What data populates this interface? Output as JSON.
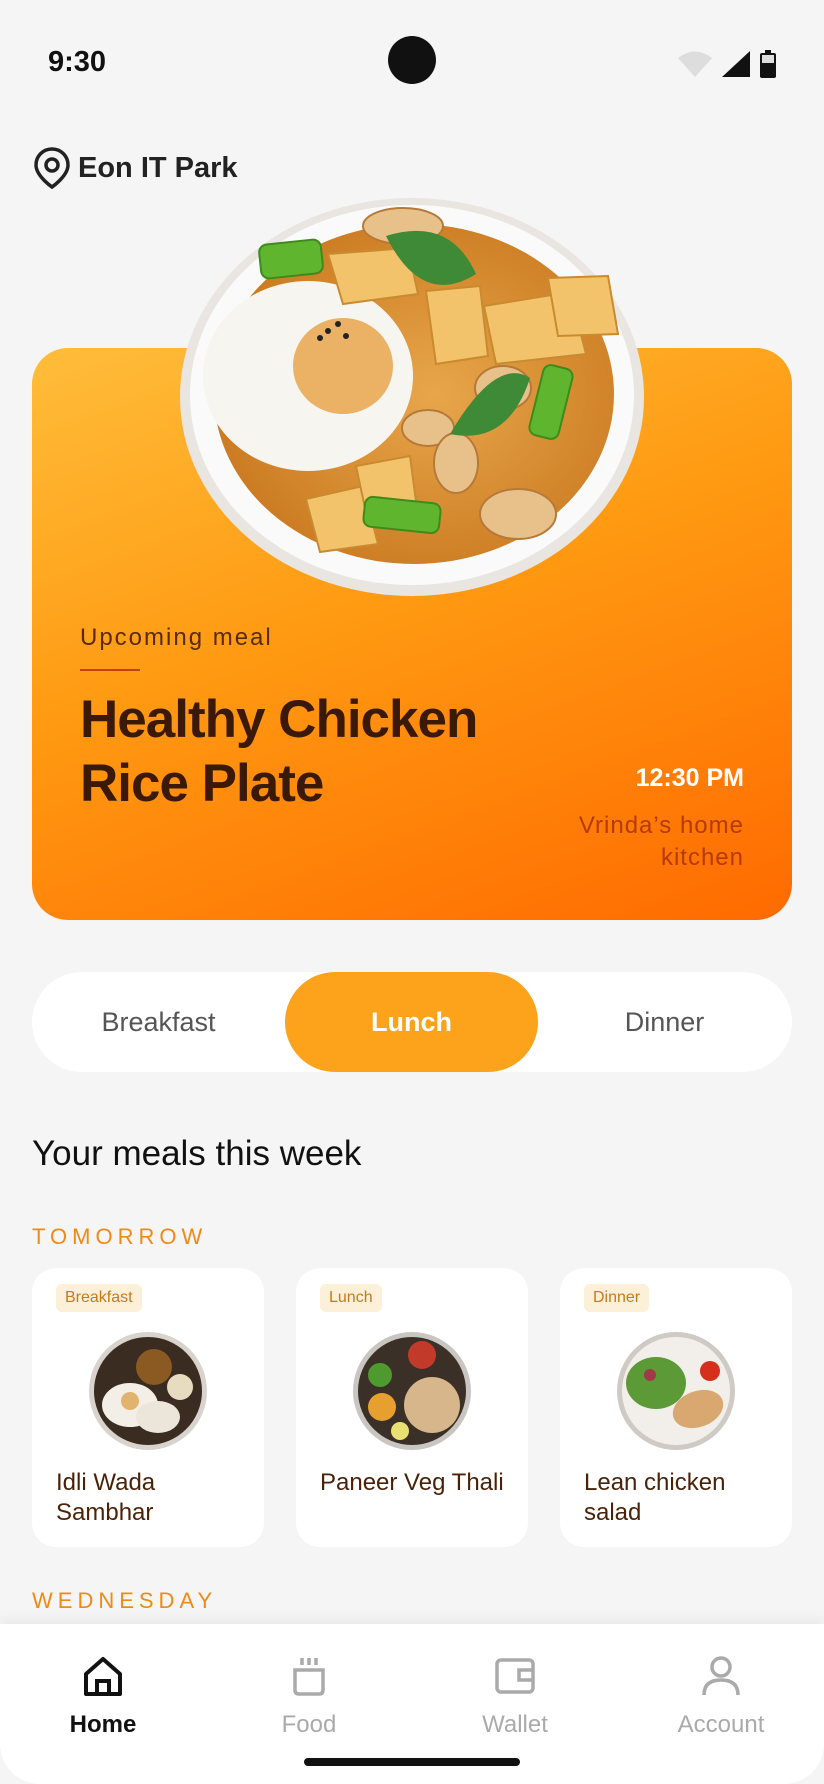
{
  "status_bar": {
    "time": "9:30"
  },
  "location": {
    "label": "Eon IT Park"
  },
  "hero": {
    "subtitle": "Upcoming meal",
    "title": "Healthy Chicken Rice Plate",
    "time": "12:30 PM",
    "kitchen": "Vrinda’s home kitchen"
  },
  "segment": {
    "options": [
      "Breakfast",
      "Lunch",
      "Dinner"
    ],
    "selected": "Lunch"
  },
  "section": {
    "title": "Your meals this week"
  },
  "days": [
    {
      "label": "TOMORROW",
      "meals": [
        {
          "tag": "Breakfast",
          "name": "Idli Wada Sambhar"
        },
        {
          "tag": "Lunch",
          "name": "Paneer Veg Thali"
        },
        {
          "tag": "Dinner",
          "name": "Lean chicken salad"
        }
      ]
    },
    {
      "label": "WEDNESDAY"
    }
  ],
  "nav": {
    "items": [
      {
        "label": "Home",
        "icon": "home-icon",
        "active": true
      },
      {
        "label": "Food",
        "icon": "food-icon"
      },
      {
        "label": "Wallet",
        "icon": "wallet-icon"
      },
      {
        "label": "Account",
        "icon": "account-icon"
      }
    ]
  },
  "colors": {
    "accent": "#fca21b",
    "hero_top": "#ffbd3a",
    "hero_bottom": "#ff6a00",
    "day_label": "#f08a17"
  }
}
